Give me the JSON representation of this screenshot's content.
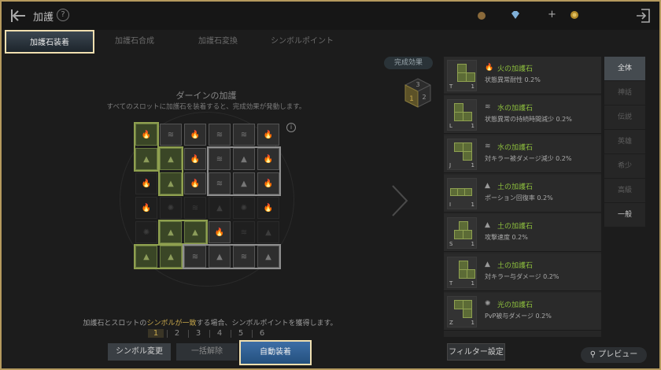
{
  "header": {
    "title": "加護",
    "help_label": "?"
  },
  "currencies": [
    {
      "icon": "coin-pouch-icon",
      "value": ""
    },
    {
      "icon": "diamond-icon",
      "value": ""
    },
    {
      "icon": "plus-icon",
      "value": "+"
    },
    {
      "icon": "gold-coin-icon",
      "value": ""
    }
  ],
  "tabs": [
    {
      "label": "加護石装着",
      "active": true
    },
    {
      "label": "加護石合成",
      "active": false
    },
    {
      "label": "加護石変換",
      "active": false
    },
    {
      "label": "シンボルポイント",
      "active": false
    }
  ],
  "completion_button": "完成効果",
  "cube": {
    "top": "3",
    "left": "1",
    "right": "2"
  },
  "board": {
    "title": "ダーインの加護",
    "description": "すべてのスロットに加護石を装着すると、完成効果が発動します。",
    "info_label": "i"
  },
  "symbol_note": {
    "before": "加護石とスロットの",
    "highlight": "シンボルが一致",
    "after": "する場合、シンボルポイントを獲得します。"
  },
  "steps": [
    "1",
    "2",
    "3",
    "4",
    "5",
    "6"
  ],
  "buttons": {
    "symbol_change": "シンボル変更",
    "release_all": "一括解除",
    "auto_equip": "自動装着",
    "filter": "フィルター設定",
    "preview": "プレビュー"
  },
  "items": [
    {
      "name": "火の加護石",
      "desc": "状態異常耐性 0.2%",
      "letter": "T",
      "num": "1",
      "elem": "fire-icon"
    },
    {
      "name": "水の加護石",
      "desc": "状態異常の持続時間減少 0.2%",
      "letter": "L",
      "num": "1",
      "elem": "water-icon"
    },
    {
      "name": "水の加護石",
      "desc": "対キラー被ダメージ減少 0.2%",
      "letter": "J",
      "num": "1",
      "elem": "water-icon"
    },
    {
      "name": "土の加護石",
      "desc": "ポーション回復率 0.2%",
      "letter": "I",
      "num": "1",
      "elem": "earth-icon"
    },
    {
      "name": "土の加護石",
      "desc": "攻撃速度 0.2%",
      "letter": "S",
      "num": "1",
      "elem": "earth-icon"
    },
    {
      "name": "土の加護石",
      "desc": "対キラー与ダメージ 0.2%",
      "letter": "T",
      "num": "1",
      "elem": "earth-icon"
    },
    {
      "name": "光の加護石",
      "desc": "PvP被与ダメージ 0.2%",
      "letter": "Z",
      "num": "1",
      "elem": "light-icon"
    }
  ],
  "filters": [
    {
      "label": "全体",
      "state": "active"
    },
    {
      "label": "神話",
      "state": "dim"
    },
    {
      "label": "伝説",
      "state": "dim"
    },
    {
      "label": "英雄",
      "state": "dim"
    },
    {
      "label": "希少",
      "state": "dim"
    },
    {
      "label": "高級",
      "state": "dim"
    },
    {
      "label": "一般",
      "state": "mid"
    }
  ]
}
